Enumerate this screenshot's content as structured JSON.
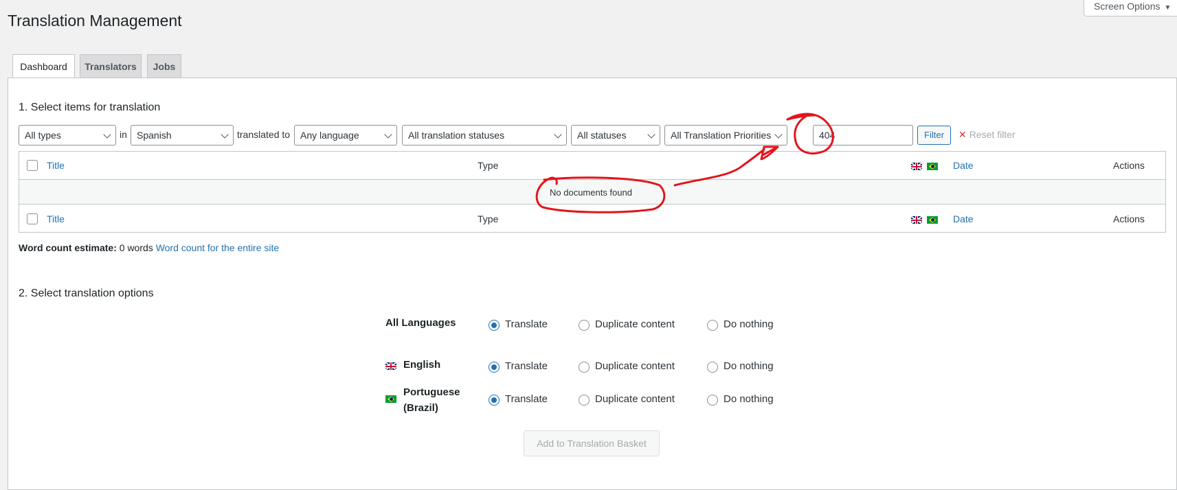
{
  "page": {
    "title": "Translation Management"
  },
  "screen_options": {
    "label": "Screen Options"
  },
  "tabs": [
    {
      "label": "Dashboard",
      "active": true
    },
    {
      "label": "Translators",
      "active": false
    },
    {
      "label": "Jobs",
      "active": false
    }
  ],
  "section1": {
    "heading": "1. Select items for translation",
    "filters": {
      "type_select": "All types",
      "in_label": "in",
      "language_select": "Spanish",
      "translated_to_label": "translated to",
      "target_language_select": "Any language",
      "translation_status_select": "All translation statuses",
      "status_select": "All statuses",
      "priority_select": "All Translation Priorities",
      "search_value": "404",
      "filter_button": "Filter",
      "reset_filter": "Reset filter"
    },
    "table": {
      "columns": {
        "title": "Title",
        "type": "Type",
        "date": "Date",
        "actions": "Actions"
      },
      "empty_message": "No documents found"
    },
    "word_count": {
      "label": "Word count estimate:",
      "value": "0 words",
      "link": "Word count for the entire site"
    }
  },
  "section2": {
    "heading": "2. Select translation options",
    "rows": [
      {
        "language": "All Languages",
        "flag": null,
        "selected": "Translate"
      },
      {
        "language": "English",
        "flag": "uk-flag",
        "selected": "Translate"
      },
      {
        "language_line1": "Portuguese",
        "language_line2": "(Brazil)",
        "flag": "brazil-flag",
        "selected": "Translate"
      }
    ],
    "options": {
      "translate": "Translate",
      "duplicate": "Duplicate content",
      "nothing": "Do nothing"
    },
    "submit_button": "Add to Translation Basket"
  },
  "colors": {
    "accent": "#2271b1",
    "annotation": "#e3141b",
    "reset_x": "#d63638"
  }
}
